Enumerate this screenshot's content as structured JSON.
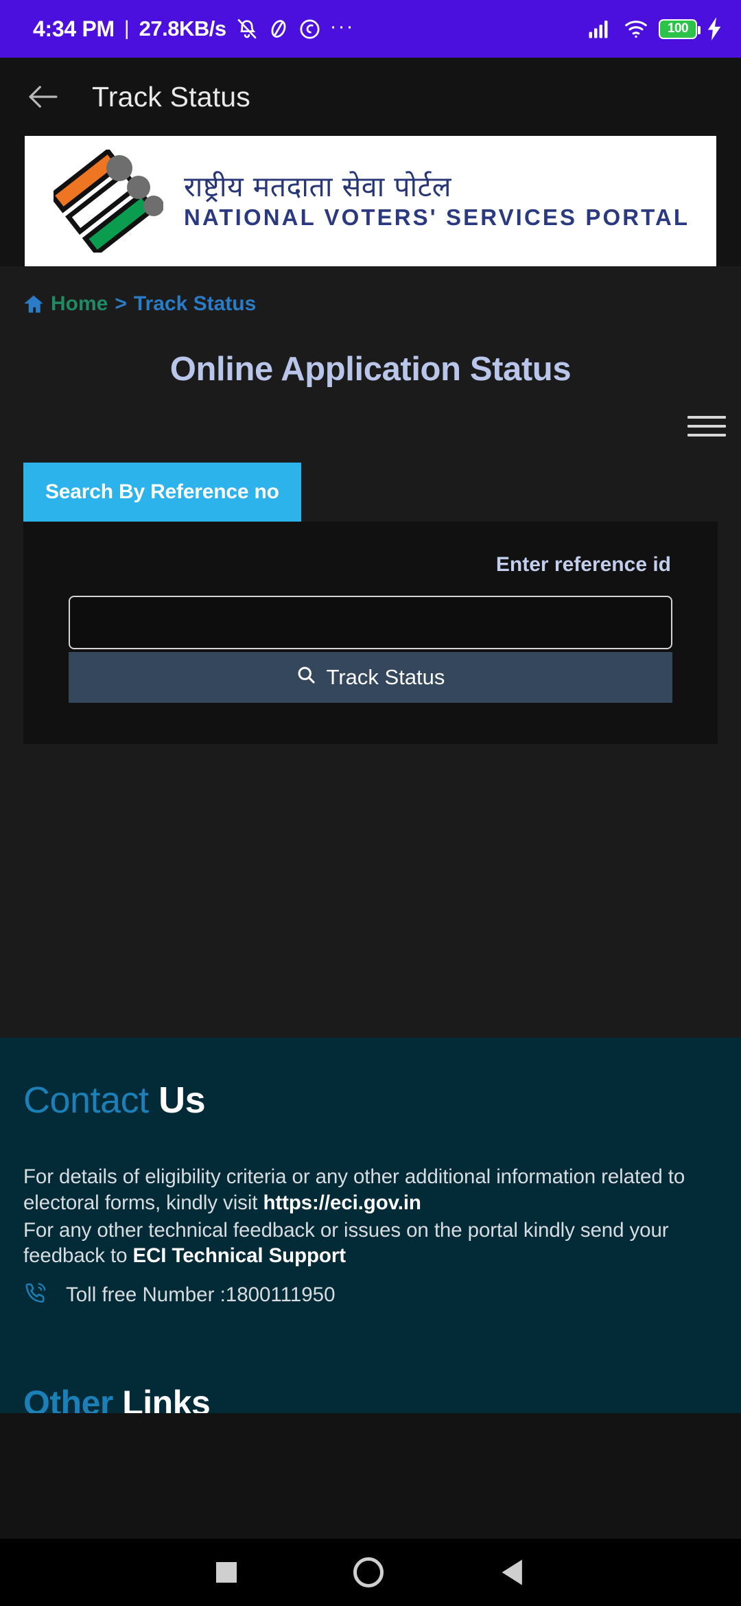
{
  "status_bar": {
    "time": "4:34 PM",
    "separator": "|",
    "network_speed": "27.8KB/s",
    "overflow_dots": "···",
    "battery_level": "100",
    "icons": [
      "mute-icon",
      "dnd-icon",
      "data-saver-icon",
      "more-icon",
      "cellular-signal-icon",
      "wifi-icon",
      "battery-icon",
      "charging-bolt-icon"
    ]
  },
  "app_bar": {
    "back_label": "back-arrow",
    "title": "Track Status"
  },
  "banner": {
    "hindi_title": "राष्ट्रीय मतदाता सेवा पोर्टल",
    "english_title": "NATIONAL VOTERS' SERVICES PORTAL",
    "logo_alt": "eci-logo"
  },
  "breadcrumb": {
    "home": "Home",
    "separator": ">",
    "current": "Track Status",
    "home_color": "#1f8a63",
    "link_color": "#2a7cc7"
  },
  "main": {
    "heading": "Online Application Status",
    "heading_color": "#b9c6ea",
    "tab_label": "Search By Reference no",
    "tab_color": "#2db3ec",
    "field_label": "Enter reference id",
    "input_value": "",
    "input_placeholder": "",
    "submit_label": "Track Status",
    "submit_color": "#35475c"
  },
  "footer": {
    "contact_blue": "Contact",
    "contact_white": "Us",
    "para1_a": "For details of eligibility criteria or any other additional information related to electoral forms, kindly visit ",
    "para1_link": "https://eci.gov.in",
    "para2_a": "For any other technical feedback or issues on the portal kindly send your feedback to ",
    "para2_link": "ECI Technical Support",
    "toll_free": "Toll free Number :1800111950",
    "other_links_blue": "Other",
    "other_links_white": " Links",
    "background": "#032a37",
    "accent": "#1b80b8"
  },
  "nav_bar": {
    "recents": "recents-square-icon",
    "home": "home-circle-icon",
    "back": "back-triangle-icon"
  }
}
